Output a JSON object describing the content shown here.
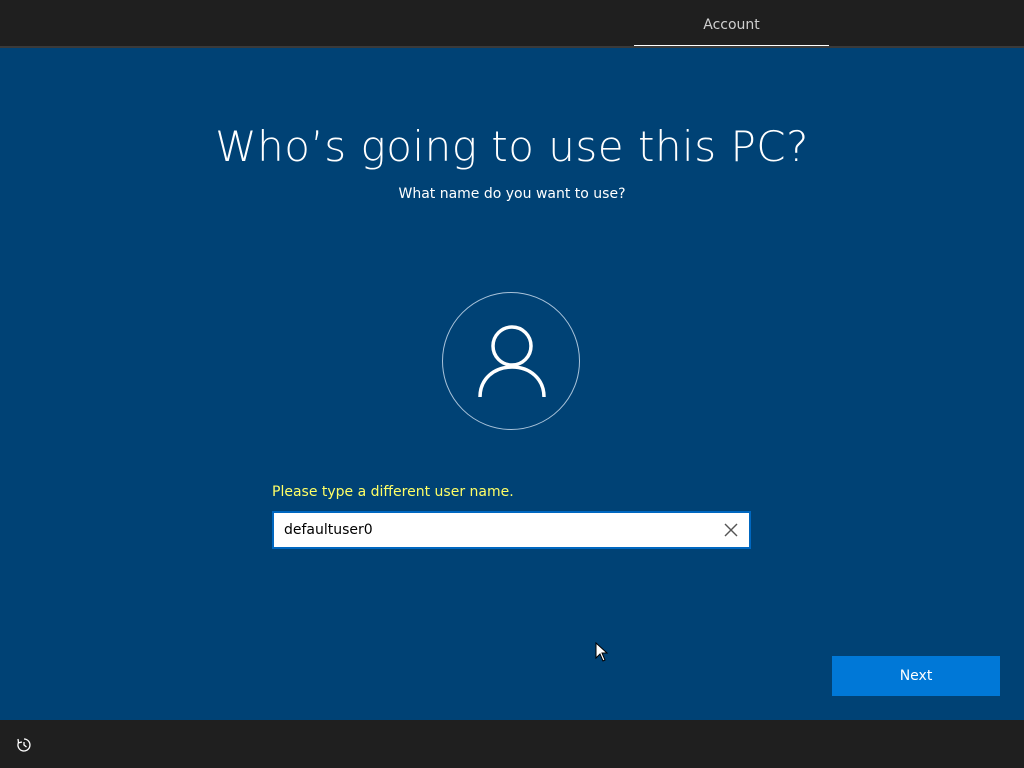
{
  "header": {
    "tab_account": "Account"
  },
  "main": {
    "title": "Who’s going to use this PC?",
    "subtitle": "What name do you want to use?",
    "error_message": "Please type a different user name.",
    "username_value": "defaultuser0",
    "next_label": "Next"
  },
  "icons": {
    "avatar": "person-icon",
    "clear": "close-icon",
    "ease_of_access": "ease-of-access-icon"
  },
  "colors": {
    "background": "#004275",
    "bars": "#1f1f1f",
    "accent": "#0078d7",
    "error": "#ffff66"
  }
}
